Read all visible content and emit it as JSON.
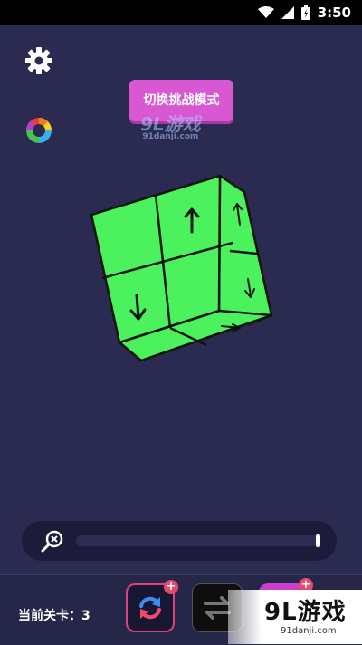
{
  "status_bar": {
    "time": "3:50",
    "icons": [
      "wifi-icon",
      "signal-icon",
      "battery-charging-icon"
    ]
  },
  "toolbar": {
    "settings_icon": "gear-icon",
    "color_icon": "color-wheel-icon",
    "mode_button_label": "切换挑战模式"
  },
  "watermark": {
    "top_logo": "9L游戏",
    "top_url": "91danji.com",
    "bottom_logo": "9L游戏",
    "bottom_url": "91danji.com"
  },
  "cube": {
    "front_faces": [
      "blank",
      "arrow-up",
      "arrow-down",
      "blank"
    ],
    "colors": {
      "face": "#4cf25e",
      "edge": "#0b160b"
    }
  },
  "zoom": {
    "icon": "zoom-out-icon",
    "level": 1.0
  },
  "bottom": {
    "level_label": "当前关卡：3",
    "reset_icon": "refresh-icon",
    "swap_icon": "swap-icon",
    "plus": "+"
  },
  "colors": {
    "background": "#2b2b52",
    "accent": "#d957d3",
    "cube_green": "#4cf25e"
  }
}
